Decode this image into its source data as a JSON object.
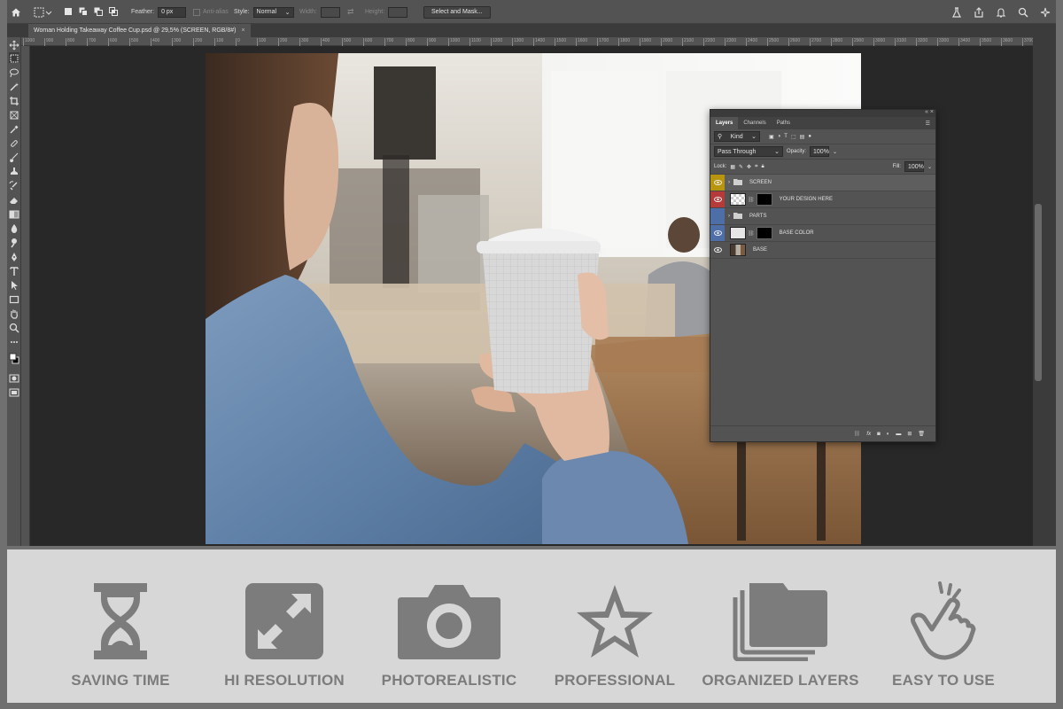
{
  "options_bar": {
    "feather_label": "Feather:",
    "feather_value": "0 px",
    "antialias_label": "Anti-alias",
    "style_label": "Style:",
    "style_value": "Normal",
    "width_label": "Width:",
    "height_label": "Height:",
    "select_mask_label": "Select and Mask..."
  },
  "document_tab": {
    "title": "Woman Holding Takeaway Coffee Cup.psd @ 29,5% (SCREEN, RGB/8#)",
    "close": "×"
  },
  "ruler_ticks": [
    "1000",
    "900",
    "800",
    "700",
    "600",
    "500",
    "400",
    "300",
    "200",
    "100",
    "0",
    "100",
    "200",
    "300",
    "400",
    "500",
    "600",
    "700",
    "800",
    "900",
    "1000",
    "1100",
    "1200",
    "1300",
    "1400",
    "1500",
    "1600",
    "1700",
    "1800",
    "1900",
    "2000",
    "2100",
    "2200",
    "2300",
    "2400",
    "2500",
    "2600",
    "2700",
    "2800",
    "2900",
    "3000",
    "3100",
    "3200",
    "3300",
    "3400",
    "3500",
    "3600",
    "3700",
    "3800"
  ],
  "layers_panel": {
    "tabs": [
      "Layers",
      "Channels",
      "Paths"
    ],
    "filter_label": "Kind",
    "blend_mode": "Pass Through",
    "opacity_label": "Opacity:",
    "opacity_value": "100%",
    "lock_label": "Lock:",
    "fill_label": "Fill:",
    "fill_value": "100%",
    "layers": [
      {
        "name": "SCREEN",
        "type": "group",
        "color": "#b8950f"
      },
      {
        "name": "YOUR DESIGN HERE",
        "type": "smart",
        "color": "#b53a3a"
      },
      {
        "name": "PARTS",
        "type": "group",
        "color": "#4e6ea8"
      },
      {
        "name": "BASE COLOR",
        "type": "fill",
        "color": "#4e6ea8"
      },
      {
        "name": "BASE",
        "type": "image",
        "color": "#535353"
      }
    ]
  },
  "features": [
    {
      "label": "SAVING TIME",
      "icon": "hourglass-icon"
    },
    {
      "label": "HI RESOLUTION",
      "icon": "expand-arrows-icon"
    },
    {
      "label": "PHOTOREALISTIC",
      "icon": "camera-icon"
    },
    {
      "label": "PROFESSIONAL",
      "icon": "star-icon"
    },
    {
      "label": "ORGANIZED LAYERS",
      "icon": "stacked-layers-icon"
    },
    {
      "label": "EASY TO USE",
      "icon": "tap-hand-icon"
    }
  ],
  "colors": {
    "feature_icon": "#7c7c7c",
    "feature_bg": "#d7d7d7",
    "ps_ui": "#535353"
  }
}
